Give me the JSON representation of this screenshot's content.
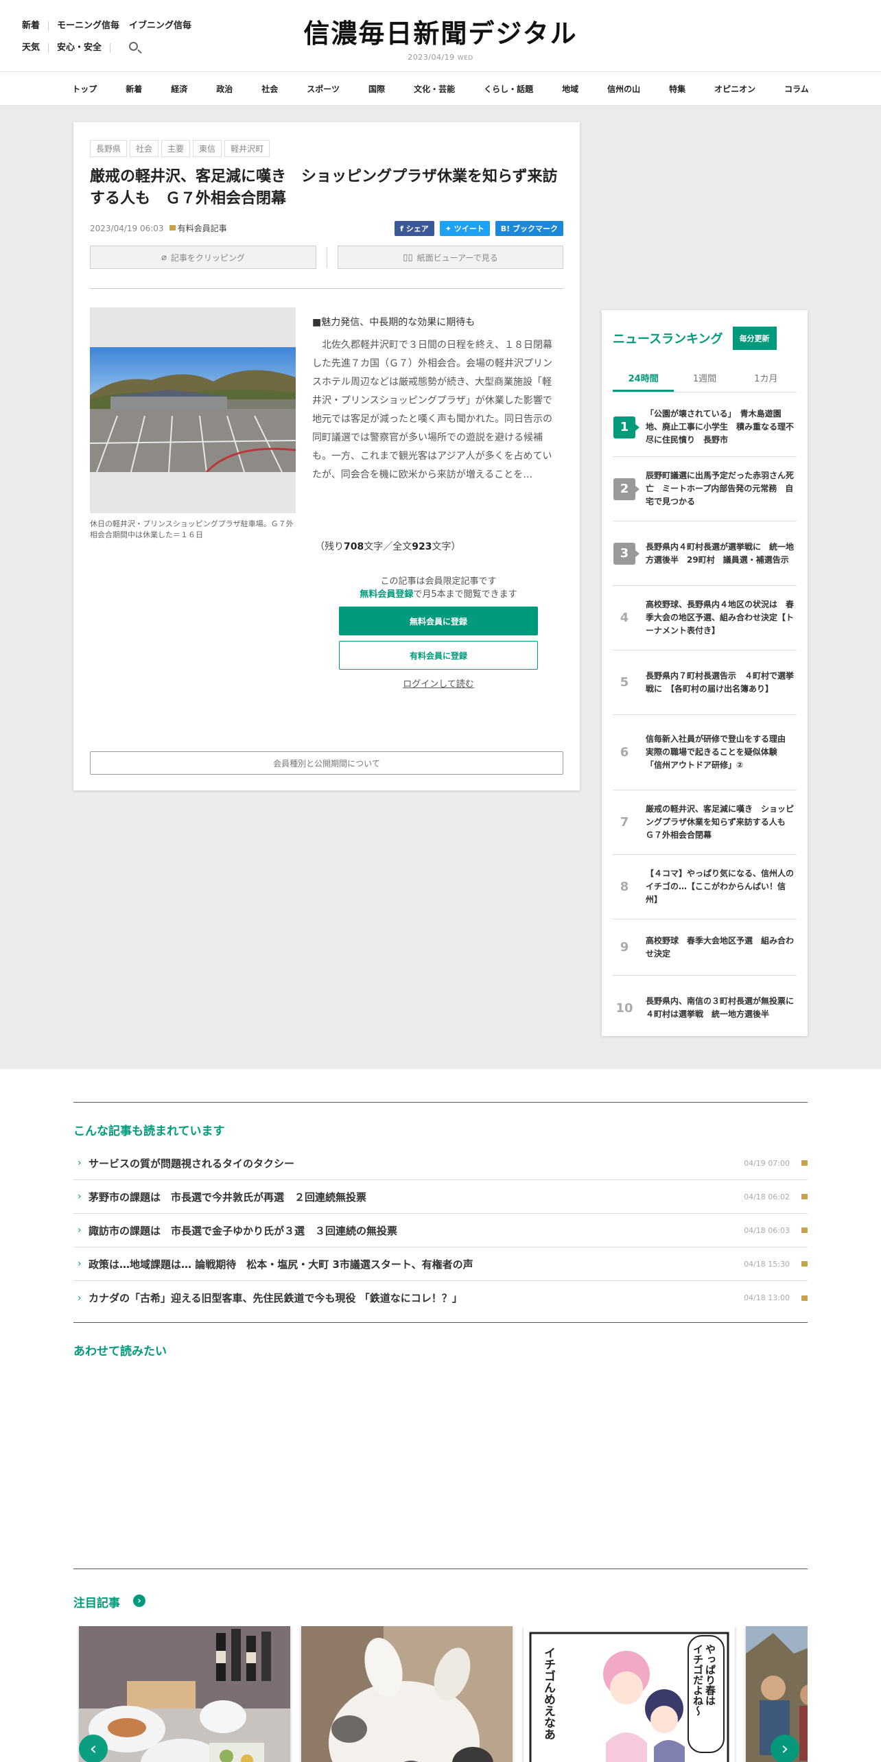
{
  "header": {
    "links_row1": [
      "新着",
      "モーニング信毎",
      "イブニング信毎"
    ],
    "links_row2": [
      "天気",
      "安心・安全"
    ],
    "logo": "信濃毎日新聞デジタル",
    "date": "2023/04/19",
    "weekday": "WED"
  },
  "nav": [
    "トップ",
    "新着",
    "経済",
    "政治",
    "社会",
    "スポーツ",
    "国際",
    "文化・芸能",
    "くらし・話題",
    "地域",
    "信州の山",
    "特集",
    "オピニオン",
    "コラム"
  ],
  "article": {
    "tags": [
      "長野県",
      "社会",
      "主要",
      "東信",
      "軽井沢町"
    ],
    "title": "厳戒の軽井沢、客足減に嘆き　ショッピングプラザ休業を知らず来訪する人も　Ｇ７外相会合閉幕",
    "datetime": "2023/04/19 06:03",
    "paid_label": "有料会員記事",
    "share": {
      "facebook": "シェア",
      "twitter": "ツイート",
      "hatena": "ブックマーク"
    },
    "clip_label": "記事をクリッピング",
    "viewer_label": "紙面ビューアーで見る",
    "caption": "休日の軽井沢・プリンスショッピングプラザ駐車場。Ｇ７外相会合期間中は休業した＝１６日",
    "subheading": "■魅力発信、中長期的な効果に期待も",
    "body": "北佐久郡軽井沢町で３日間の日程を終え、１８日閉幕した先進７カ国（Ｇ７）外相会合。会場の軽井沢プリンスホテル周辺などは厳戒態勢が続き、大型商業施設「軽井沢・プリンスショッピングプラザ」が休業した影響で地元では客足が減ったと嘆く声も聞かれた。同日告示の同町議選では警察官が多い場所での遊説を避ける候補も。一方、これまで観光客はアジア人が多くを占めていたが、同会合を機に欧米から来訪が増えることを…",
    "remain_prefix": "（残り",
    "remain_count": "708",
    "remain_mid": "文字／全文",
    "total_count": "923",
    "remain_suffix": "文字）",
    "member_line1": "この記事は会員限定記事です",
    "member_reg": "無料会員登録",
    "member_line2_rest": "で月5本まで閲覧できます",
    "btn_free": "無料会員に登録",
    "btn_paid": "有料会員に登録",
    "login": "ログインして読む",
    "about": "会員種別と公開期間について"
  },
  "ranking": {
    "title": "ニュースランキング",
    "update": "毎分更新",
    "tabs": [
      "24時間",
      "1週間",
      "1カ月"
    ],
    "items": [
      {
        "rank": "1",
        "text": "「公園が壊されている」　青木島遊園地、廃止工事に小学生　積み重なる理不尽に住民憤り　長野市"
      },
      {
        "rank": "2",
        "text": "辰野町議選に出馬予定だった赤羽さん死亡　ミートホープ内部告発の元常務　自宅で見つかる"
      },
      {
        "rank": "3",
        "text": "長野県内４町村長選が選挙戦に　統一地方選後半　29町村　議員選・補選告示"
      },
      {
        "rank": "4",
        "text": "高校野球、長野県内４地区の状況は　春季大会の地区予選、組み合わせ決定【トーナメント表付き】"
      },
      {
        "rank": "5",
        "text": "長野県内７町村長選告示　４町村で選挙戦に　【各町村の届け出名簿あり】"
      },
      {
        "rank": "6",
        "text": "信毎新入社員が研修で登山をする理由　実際の職場で起きることを疑似体験　「信州アウトドア研修」②"
      },
      {
        "rank": "7",
        "text": "厳戒の軽井沢、客足減に嘆き　ショッピングプラザ休業を知らず来訪する人も　Ｇ７外相会合閉幕"
      },
      {
        "rank": "8",
        "text": "【４コマ】やっぱり気になる、信州人のイチゴの…【ここがわからんぱい！信州】"
      },
      {
        "rank": "9",
        "text": "高校野球　春季大会地区予選　組み合わせ決定"
      },
      {
        "rank": "10",
        "text": "長野県内、南信の３町村長選が無投票に　４町村は選挙戦　統一地方選後半"
      }
    ]
  },
  "also_read": {
    "title": "こんな記事も読まれています",
    "items": [
      {
        "text": "サービスの質が問題視されるタイのタクシー",
        "date": "04/19 07:00"
      },
      {
        "text": "茅野市の課題は　市長選で今井敦氏が再選　２回連続無投票",
        "date": "04/18 06:02"
      },
      {
        "text": "諏訪市の課題は　市長選で金子ゆかり氏が３選　３回連続の無投票",
        "date": "04/18 06:03"
      },
      {
        "text": "政策は…地域課題は… 論戦期待　松本・塩尻・大町 3市議選スタート、有権者の声",
        "date": "04/18 15:30"
      },
      {
        "text": "カナダの「古希」迎える旧型客車、先住民鉄道で今も現役 「鉄道なにコレ！？」",
        "date": "04/18 13:00"
      }
    ]
  },
  "together": {
    "title": "あわせて読みたい"
  },
  "featured": {
    "title": "注目記事",
    "manga_text1": "やっぱり春は",
    "manga_text2": "イチゴだよね〜",
    "manga_text3": "イチゴんめえなあ"
  },
  "colors": {
    "accent": "#009b7c",
    "rank_gray": "#999999",
    "lock": "#c7a24c"
  }
}
